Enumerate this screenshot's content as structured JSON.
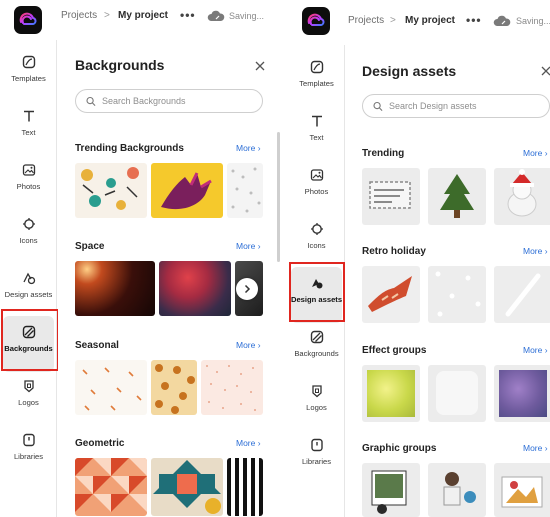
{
  "left": {
    "breadcrumb": {
      "projects": "Projects",
      "separator": ">",
      "current": "My project"
    },
    "more_dots": "•••",
    "saving": "Saving...",
    "rail": [
      {
        "label": "Templates",
        "icon": "templates-icon"
      },
      {
        "label": "Text",
        "icon": "text-icon"
      },
      {
        "label": "Photos",
        "icon": "photos-icon"
      },
      {
        "label": "Icons",
        "icon": "icons-icon"
      },
      {
        "label": "Design assets",
        "icon": "design-assets-icon"
      },
      {
        "label": "Backgrounds",
        "icon": "backgrounds-icon",
        "active": true
      },
      {
        "label": "Logos",
        "icon": "logos-icon"
      },
      {
        "label": "Libraries",
        "icon": "libraries-icon"
      }
    ],
    "panel": {
      "title": "Backgrounds",
      "search_placeholder": "Search Backgrounds",
      "sections": [
        {
          "title": "Trending Backgrounds",
          "more": "More"
        },
        {
          "title": "Space",
          "more": "More"
        },
        {
          "title": "Seasonal",
          "more": "More"
        },
        {
          "title": "Geometric",
          "more": "More"
        }
      ]
    }
  },
  "right": {
    "breadcrumb": {
      "projects": "Projects",
      "separator": ">",
      "current": "My project"
    },
    "more_dots": "•••",
    "saving": "Saving...",
    "rail": [
      {
        "label": "Templates",
        "icon": "templates-icon"
      },
      {
        "label": "Text",
        "icon": "text-icon"
      },
      {
        "label": "Photos",
        "icon": "photos-icon"
      },
      {
        "label": "Icons",
        "icon": "icons-icon"
      },
      {
        "label": "Design assets",
        "icon": "design-assets-icon",
        "active": true
      },
      {
        "label": "Backgrounds",
        "icon": "backgrounds-icon"
      },
      {
        "label": "Logos",
        "icon": "logos-icon"
      },
      {
        "label": "Libraries",
        "icon": "libraries-icon"
      }
    ],
    "panel": {
      "title": "Design assets",
      "search_placeholder": "Search Design assets",
      "sections": [
        {
          "title": "Trending",
          "more": "More"
        },
        {
          "title": "Retro holiday",
          "more": "More"
        },
        {
          "title": "Effect groups",
          "more": "More"
        },
        {
          "title": "Graphic groups",
          "more": "More"
        }
      ]
    }
  },
  "colors": {
    "accent": "#2d6fd6",
    "highlight_box": "#e0261f",
    "logo_bg": "#0d0d0d"
  }
}
